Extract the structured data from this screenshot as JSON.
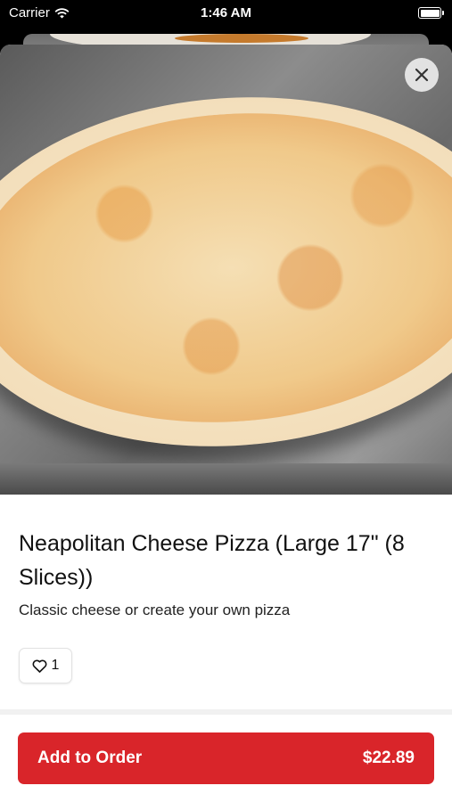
{
  "status_bar": {
    "carrier": "Carrier",
    "time": "1:46 AM"
  },
  "item": {
    "title": "Neapolitan Cheese Pizza (Large 17\" (8 Slices))",
    "description": "Classic cheese or create your own pizza",
    "likes": "1"
  },
  "footer": {
    "add_label": "Add to Order",
    "price": "$22.89"
  },
  "icons": {
    "close": "close-icon",
    "heart": "heart-icon",
    "wifi": "wifi-icon",
    "battery": "battery-icon"
  },
  "colors": {
    "accent": "#d9252a"
  }
}
